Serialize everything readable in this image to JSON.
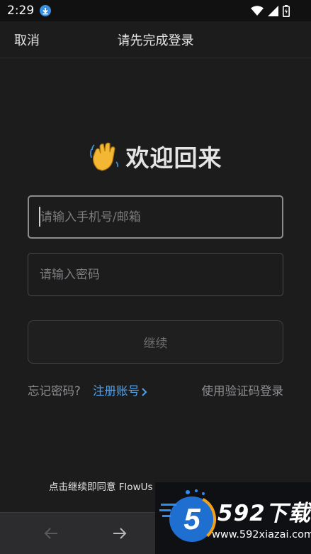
{
  "status_bar": {
    "time": "2:29"
  },
  "header": {
    "cancel_label": "取消",
    "title": "请先完成登录"
  },
  "welcome": {
    "text": "欢迎回来"
  },
  "form": {
    "phone_placeholder": "请输入手机号/邮箱",
    "password_placeholder": "请输入密码",
    "continue_label": "继续"
  },
  "links": {
    "forgot_password": "忘记密码?",
    "register": "注册账号",
    "code_login": "使用验证码登录"
  },
  "agreement": {
    "text": "点击继续即同意 FlowUs"
  },
  "watermark": {
    "brand": "592下载",
    "url": "www.592xiazai.com",
    "logo_text": "5"
  },
  "colors": {
    "accent": "#4da3f0",
    "background": "#1c1c1d"
  }
}
